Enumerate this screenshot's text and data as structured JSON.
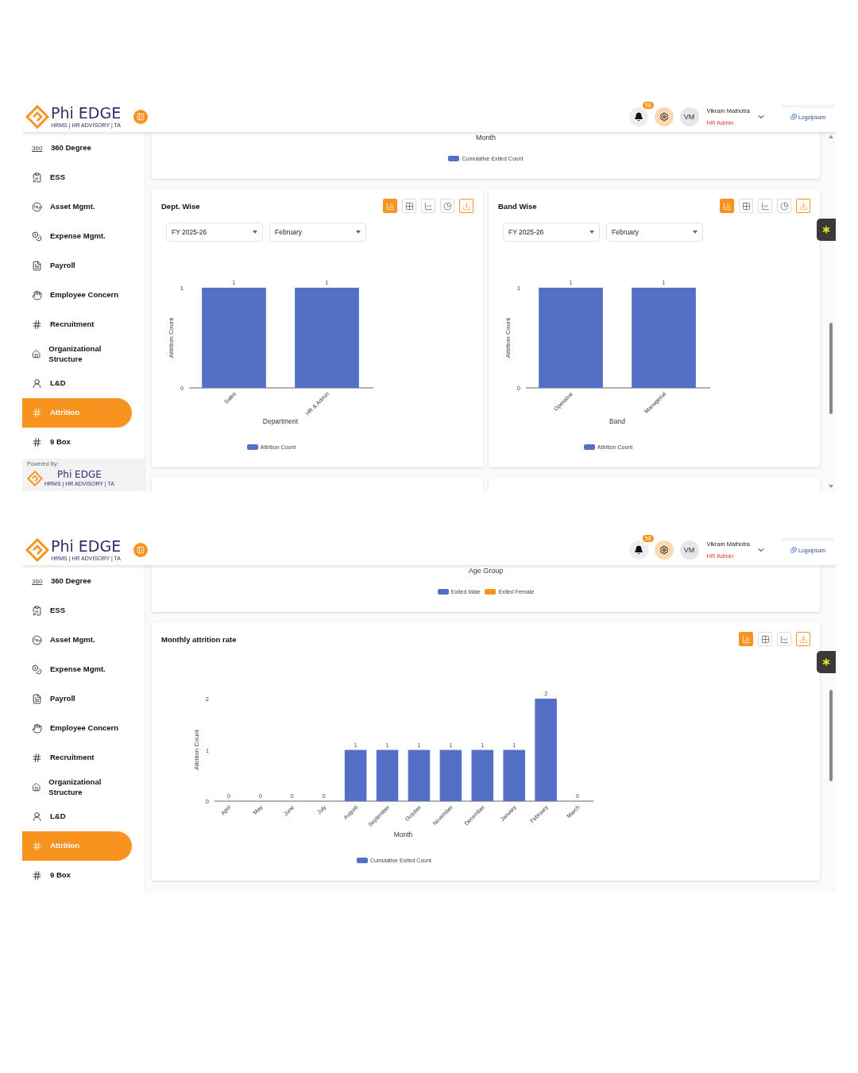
{
  "screens": [
    {
      "header": {
        "brand": "Phi EDGE",
        "tagline": "HRMS | HR ADVISORY | TA",
        "notifications": "58",
        "avatar": "VM",
        "user_name": "Vikram Malhotra",
        "user_role": "HR Admin",
        "company": "Logoipsum"
      },
      "sidebar": {
        "items": [
          {
            "label": "360 Degree",
            "icon_text": "360",
            "selected": false
          },
          {
            "label": "ESS",
            "selected": false
          },
          {
            "label": "Asset Mgmt.",
            "selected": false
          },
          {
            "label": "Expense Mgmt.",
            "selected": false
          },
          {
            "label": "Payroll",
            "selected": false
          },
          {
            "label": "Employee Concern",
            "selected": false
          },
          {
            "label": "Recruitment",
            "selected": false
          },
          {
            "label": "Organizational Structure",
            "selected": false
          },
          {
            "label": "L&D",
            "selected": false
          },
          {
            "label": "Attrition",
            "selected": true
          },
          {
            "label": "9 Box",
            "selected": false
          }
        ],
        "powered_by": {
          "label": "Powered By:",
          "brand": "Phi EDGE",
          "tagline": "HRMS | HR ADVISORY | TA"
        }
      },
      "panels": [
        {
          "kind": "tail",
          "axis_title": "Month",
          "legend": [
            {
              "name": "Cumulative Exited Count",
              "color": "#5470c6"
            }
          ]
        },
        {
          "kind": "pair",
          "cards": [
            {
              "title": "Dept. Wise",
              "filters": [
                {
                  "value": "FY 2025-26"
                },
                {
                  "value": "February"
                }
              ],
              "toolbar": [
                {
                  "kind": "bar",
                  "selected": true
                },
                {
                  "kind": "table",
                  "selected": false
                },
                {
                  "kind": "line",
                  "selected": false
                },
                {
                  "kind": "pie",
                  "selected": false
                },
                {
                  "kind": "download"
                }
              ],
              "chart_data": {
                "type": "bar",
                "xlabel": "Department",
                "ylabel": "Attrition Count",
                "categories": [
                  "Sales",
                  "HR & Admin"
                ],
                "series": [
                  {
                    "name": "Attrition Count",
                    "color": "#5470c6",
                    "values": [
                      1,
                      1
                    ]
                  }
                ],
                "yticks": [
                  0,
                  1
                ],
                "ylim": [
                  0,
                  1
                ],
                "data_labels": true
              }
            },
            {
              "title": "Band Wise",
              "filters": [
                {
                  "value": "FY 2025-26"
                },
                {
                  "value": "February"
                }
              ],
              "toolbar": [
                {
                  "kind": "bar",
                  "selected": true
                },
                {
                  "kind": "table",
                  "selected": false
                },
                {
                  "kind": "line",
                  "selected": false
                },
                {
                  "kind": "pie",
                  "selected": false
                },
                {
                  "kind": "download"
                }
              ],
              "chart_data": {
                "type": "bar",
                "xlabel": "Band",
                "ylabel": "Attrition Count",
                "categories": [
                  "Operative",
                  "Managerial"
                ],
                "series": [
                  {
                    "name": "Attrition Count",
                    "color": "#5470c6",
                    "values": [
                      1,
                      1
                    ]
                  }
                ],
                "yticks": [
                  0,
                  1
                ],
                "ylim": [
                  0,
                  1
                ],
                "data_labels": true
              }
            }
          ]
        },
        {
          "kind": "stubs"
        }
      ]
    },
    {
      "header": {
        "brand": "Phi EDGE",
        "tagline": "HRMS | HR ADVISORY | TA",
        "notifications": "58",
        "avatar": "VM",
        "user_name": "Vikram Malhotra",
        "user_role": "HR Admin",
        "company": "Logoipsum"
      },
      "sidebar": {
        "items": [
          {
            "label": "360 Degree",
            "icon_text": "360",
            "selected": false
          },
          {
            "label": "ESS",
            "selected": false
          },
          {
            "label": "Asset Mgmt.",
            "selected": false
          },
          {
            "label": "Expense Mgmt.",
            "selected": false
          },
          {
            "label": "Payroll",
            "selected": false
          },
          {
            "label": "Employee Concern",
            "selected": false
          },
          {
            "label": "Recruitment",
            "selected": false
          },
          {
            "label": "Organizational Structure",
            "selected": false
          },
          {
            "label": "L&D",
            "selected": false
          },
          {
            "label": "Attrition",
            "selected": true
          },
          {
            "label": "9 Box",
            "selected": false
          }
        ]
      },
      "panels": [
        {
          "kind": "tail",
          "axis_title": "Age Group",
          "legend": [
            {
              "name": "Exited Male",
              "color": "#5470c6"
            },
            {
              "name": "Exited Female",
              "color": "#f7931e"
            }
          ]
        },
        {
          "kind": "wide",
          "cards": [
            {
              "title": "Monthly attrition rate",
              "toolbar": [
                {
                  "kind": "bar",
                  "selected": true
                },
                {
                  "kind": "table",
                  "selected": false
                },
                {
                  "kind": "line",
                  "selected": false
                },
                {
                  "kind": "download"
                }
              ],
              "chart_data": {
                "type": "bar",
                "xlabel": "Month",
                "ylabel": "Attrition Count",
                "categories": [
                  "April",
                  "May",
                  "June",
                  "July",
                  "August",
                  "September",
                  "October",
                  "November",
                  "December",
                  "January",
                  "February",
                  "March"
                ],
                "series": [
                  {
                    "name": "Cumulative Exited Count",
                    "color": "#5470c6",
                    "values": [
                      0,
                      0,
                      0,
                      0,
                      1,
                      1,
                      1,
                      1,
                      1,
                      1,
                      2,
                      0
                    ]
                  }
                ],
                "yticks": [
                  0,
                  1,
                  2
                ],
                "ylim": [
                  0,
                  2
                ],
                "data_labels": true
              }
            }
          ]
        },
        {
          "kind": "stubs"
        }
      ]
    }
  ]
}
